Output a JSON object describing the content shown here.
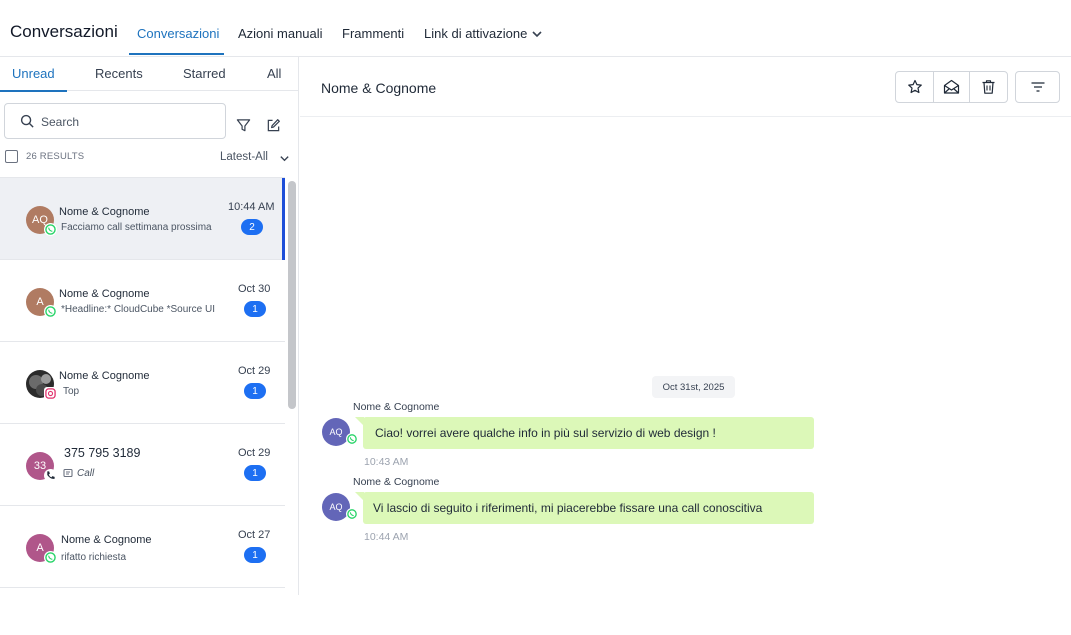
{
  "header": {
    "app_title": "Conversazioni",
    "tabs": [
      "Conversazioni",
      "Azioni manuali",
      "Frammenti",
      "Link di attivazione"
    ],
    "active_tab": "Conversazioni"
  },
  "sidebar": {
    "tabs": [
      "Unread",
      "Recents",
      "Starred",
      "All"
    ],
    "active_tab": "Unread",
    "search_placeholder": "Search",
    "results_count": "26 RESULTS",
    "sort_label": "Latest-All",
    "conversations": [
      {
        "initials": "AQ",
        "avatar_color": "#b07b62",
        "channel": "whatsapp-icon",
        "name": "Nome & Cognome",
        "preview": "Facciamo call settimana prossima",
        "time": "10:44 AM",
        "unread": "2",
        "selected": true
      },
      {
        "initials": "A",
        "avatar_color": "#b07b62",
        "channel": "whatsapp-icon",
        "name": "Nome & Cognome",
        "preview": "*Headline:* CloudCube *Source UI",
        "time": "Oct 30",
        "unread": "1",
        "selected": false
      },
      {
        "initials": "",
        "avatar_color": "#2b2b2b",
        "channel": "instagram-icon",
        "name": "Nome & Cognome",
        "preview": "Top",
        "time": "Oct 29",
        "unread": "1",
        "selected": false
      },
      {
        "initials": "33",
        "avatar_color": "#b0568a",
        "channel": "phone-icon",
        "name": "375 795 3189",
        "preview": "Call",
        "time": "Oct 29",
        "unread": "1",
        "selected": false
      },
      {
        "initials": "A",
        "avatar_color": "#b0568a",
        "channel": "whatsapp-icon",
        "name": "Nome & Cognome",
        "preview": "rifatto richiesta",
        "time": "Oct 27",
        "unread": "1",
        "selected": false
      }
    ]
  },
  "conversation": {
    "title": "Nome & Cognome",
    "date_separator": "Oct 31st, 2025",
    "messages": [
      {
        "sender": "Nome & Cognome",
        "initials": "AQ",
        "text": "Ciao! vorrei avere qualche info in più sul servizio di web design !",
        "time": "10:43 AM"
      },
      {
        "sender": "Nome & Cognome",
        "initials": "AQ",
        "text": "Vi lascio di seguito i riferimenti, mi piacerebbe fissare una call conoscitiva",
        "time": "10:44 AM"
      }
    ]
  },
  "colors": {
    "accent": "#1e73be",
    "badge": "#1d6ff2",
    "bubble": "#dcf8b8",
    "whatsapp": "#25d366"
  }
}
